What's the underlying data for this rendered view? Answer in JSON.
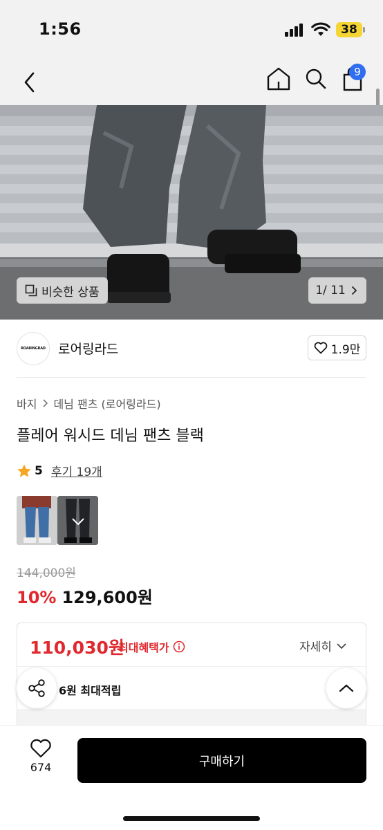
{
  "status_bar": {
    "time": "1:56",
    "battery": "38"
  },
  "nav": {
    "cart_count": "9"
  },
  "hero": {
    "similar_label": "비슷한 상품",
    "page_indicator": "1/ 11"
  },
  "brand": {
    "logo_text": "ROARINGRAD",
    "name": "로어링라드",
    "likes": "1.9만"
  },
  "breadcrumb": {
    "category": "바지",
    "subcategory": "데님 팬츠 (로어링라드)"
  },
  "product": {
    "title": "플레어 워시드 데님 팬츠 블랙",
    "rating": "5",
    "review_link": "후기 19개",
    "original_price": "144,000원",
    "discount": "10%",
    "sale_price": "129,600원"
  },
  "benefit": {
    "max_price": "110,030원",
    "label": "최대혜택가",
    "detail_toggle": "자세히",
    "points": "6원 최대적립"
  },
  "bottom_bar": {
    "wish_count": "674",
    "buy_label": "구매하기"
  },
  "colors": {
    "accent_red": "#e0292e",
    "badge_blue": "#2f6ef0",
    "buy_button": "#000000",
    "star": "#f5a623"
  }
}
